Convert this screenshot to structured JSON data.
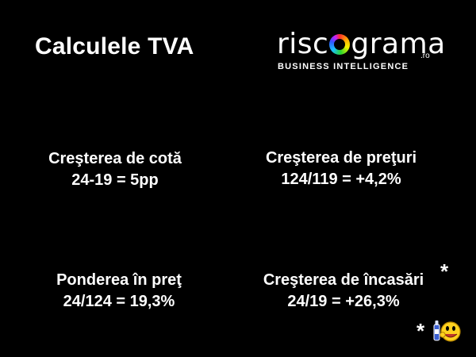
{
  "title": "Calculele TVA",
  "logo": {
    "word_pre": "risc",
    "word_post": "grama",
    "domain_suffix": ".ro",
    "tagline": "BUSINESS INTELLIGENCE",
    "ring_icon": "multicolor-ring-icon"
  },
  "blocks": [
    {
      "label": "Creşterea de cotă",
      "formula": "24-19 = 5pp"
    },
    {
      "label": "Creşterea de preţuri",
      "formula": "124/119 = +4,2%"
    },
    {
      "label": "Ponderea în preţ",
      "formula": "24/124 = 19,3%"
    },
    {
      "label": "Creşterea de încasări",
      "formula": "24/19 = +26,3%"
    }
  ],
  "footnote": {
    "star_top": "*",
    "star_bottom": "*",
    "icon": "smiley-with-bottle-icon"
  },
  "colors": {
    "background": "#000000",
    "text": "#ffffff",
    "smiley": "#ffd21f"
  }
}
